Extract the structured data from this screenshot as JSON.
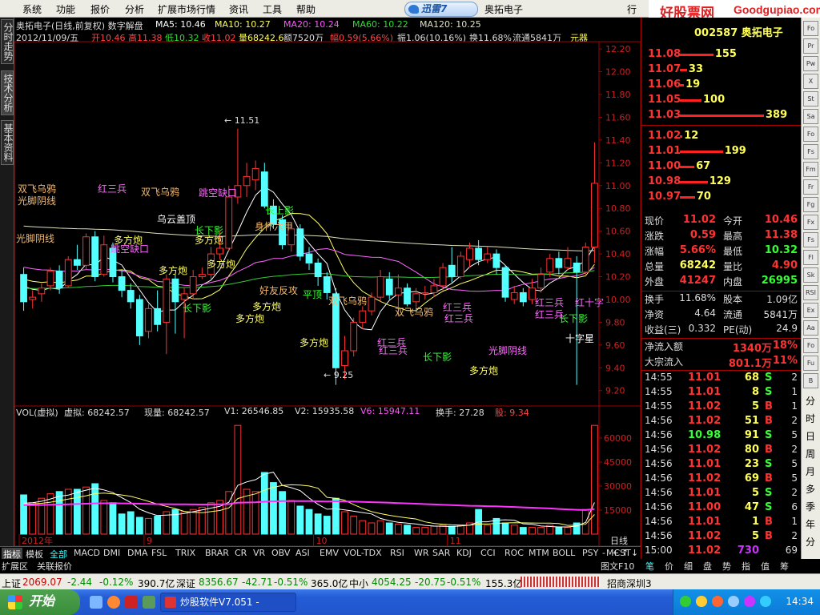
{
  "menu": [
    "系统",
    "功能",
    "报价",
    "分析",
    "扩展市场行情",
    "资讯",
    "工具",
    "帮助"
  ],
  "xunlei_label": "迅雷7",
  "window_stock_name": "奥拓电子",
  "top_right_buttons": [
    "行",
    "服务",
    "股票软件公式"
  ],
  "brand": {
    "cn": "好股票网",
    "en": "Goodgupiao.com"
  },
  "left_tabs": [
    "分时走势",
    "技术分析",
    "基本资料"
  ],
  "header": {
    "title": "奥拓电子(日线,前复权) 数字解盘",
    "ma5": "MA5: 10.46",
    "ma10": "MA10: 10.27",
    "ma20": "MA20: 10.24",
    "ma60": "MA60: 10.22",
    "ma120": "MA120: 10.25",
    "date": "2012/11/09/五",
    "open": "开10.46",
    "high": "高11.38",
    "low": "低10.32",
    "close": "收11.02",
    "vol": "量68242.6",
    "amt": "额7520万",
    "chg": "幅0.59(5.66%)",
    "amp": "振1.06(10.16%)",
    "turn": "换11.68%",
    "float": "流通5841万",
    "unit": "元器"
  },
  "vol_header": {
    "title": "VOL(虚拟)",
    "virt": "虚拟: 68242.57",
    "now": "现量: 68242.57",
    "v1": "V1: 26546.85",
    "v2": "V2: 15935.58",
    "v6": "V6: 15947.11",
    "turn": "换手: 27.28",
    "gu": "股: 9.34"
  },
  "price_axis": [
    "12.20",
    "12.00",
    "11.80",
    "11.60",
    "11.40",
    "11.20",
    "11.00",
    "10.80",
    "10.60",
    "10.40",
    "10.20",
    "10.00",
    "9.80",
    "9.60",
    "9.40",
    "9.20"
  ],
  "vol_axis": [
    "60000",
    "45000",
    "30000",
    "15000"
  ],
  "date_axis": [
    "2012年",
    "9",
    "10",
    "11"
  ],
  "period_label": "日线",
  "annotations": [
    {
      "t": "双飞乌鸦",
      "c": "#f0b870"
    },
    {
      "t": "光脚阴线",
      "c": "#f0b870"
    },
    {
      "t": "红三兵",
      "c": "#ff66ff"
    },
    {
      "t": "双飞乌鸦",
      "c": "#f0b870"
    },
    {
      "t": "光脚阴线",
      "c": "#f0b870"
    },
    {
      "t": "长下影",
      "c": "#33ff33"
    },
    {
      "t": "多方炮",
      "c": "#ffff66"
    },
    {
      "t": "跳空缺口",
      "c": "#ff66ff"
    },
    {
      "t": "多方炮",
      "c": "#ffff66"
    },
    {
      "t": "乌云盖顶",
      "c": "#ffffff"
    },
    {
      "t": "多方炮",
      "c": "#ffff66"
    },
    {
      "t": "身怀六甲",
      "c": "#f0b870"
    },
    {
      "t": "跳空缺口",
      "c": "#ff66ff"
    },
    {
      "t": "长上影",
      "c": "#33ff33"
    },
    {
      "t": "多方炮",
      "c": "#ffff66"
    },
    {
      "t": "长下影",
      "c": "#33ff33"
    },
    {
      "t": "多方炮",
      "c": "#ffff66"
    },
    {
      "t": "多方炮",
      "c": "#ffff66"
    },
    {
      "t": "好友反攻",
      "c": "#f0b870"
    },
    {
      "t": "平顶",
      "c": "#33ff33"
    },
    {
      "t": "双飞乌鸦",
      "c": "#f0b870"
    },
    {
      "t": "多方炮",
      "c": "#ffff66"
    },
    {
      "t": "红三兵",
      "c": "#ff66ff"
    },
    {
      "t": "红三兵",
      "c": "#ff66ff"
    },
    {
      "t": "双飞乌鸦",
      "c": "#f0b870"
    },
    {
      "t": "红三兵",
      "c": "#ff66ff"
    },
    {
      "t": "红三兵",
      "c": "#ff66ff"
    },
    {
      "t": "长下影",
      "c": "#33ff33"
    },
    {
      "t": "光脚阴线",
      "c": "#ff66ff"
    },
    {
      "t": "多方炮",
      "c": "#ffff66"
    },
    {
      "t": "红三兵",
      "c": "#ff66ff"
    },
    {
      "t": "红三兵",
      "c": "#ff66ff"
    },
    {
      "t": "长下影",
      "c": "#33ff33"
    },
    {
      "t": "十字星",
      "c": "#ffffff"
    },
    {
      "t": "大阴烛",
      "c": "#33ffff"
    },
    {
      "t": "红十字",
      "c": "#ff66ff"
    }
  ],
  "extreme_marks": {
    "high": "11.51",
    "low": "9.25"
  },
  "indicator_tabs": [
    "指标",
    "模板",
    "全部",
    "MACD",
    "DMI",
    "DMA",
    "FSL",
    "TRIX",
    "BRAR",
    "CR",
    "VR",
    "OBV",
    "ASI",
    "EMV",
    "VOL-TDX",
    "RSI",
    "WR",
    "SAR",
    "KDJ",
    "CCI",
    "ROC",
    "MTM",
    "BOLL",
    "PSY",
    "MCST"
  ],
  "ext_tabs": [
    "扩展区",
    "关联报价"
  ],
  "right_panel": {
    "code": "002587 奥拓电子",
    "asks": [
      {
        "p": "11.08",
        "v": "155"
      },
      {
        "p": "11.07",
        "v": "33"
      },
      {
        "p": "11.06",
        "v": "19"
      },
      {
        "p": "11.05",
        "v": "100"
      },
      {
        "p": "11.03",
        "v": "389"
      }
    ],
    "bids": [
      {
        "p": "11.02",
        "v": "12"
      },
      {
        "p": "11.01",
        "v": "199"
      },
      {
        "p": "11.00",
        "v": "67"
      },
      {
        "p": "10.98",
        "v": "129"
      },
      {
        "p": "10.97",
        "v": "70"
      }
    ],
    "quote": [
      {
        "l1": "现价",
        "v1": "11.02",
        "l2": "今开",
        "v2": "10.46"
      },
      {
        "l1": "涨跌",
        "v1": "0.59",
        "l2": "最高",
        "v2": "11.38"
      },
      {
        "l1": "涨幅",
        "v1": "5.66%",
        "l2": "最低",
        "v2": "10.32"
      },
      {
        "l1": "总量",
        "v1": "68242",
        "l2": "量比",
        "v2": "4.90"
      },
      {
        "l1": "外盘",
        "v1": "41247",
        "l2": "内盘",
        "v2": "26995"
      }
    ],
    "fund": [
      {
        "l1": "换手",
        "v1": "11.68%",
        "l2": "股本",
        "v2": "1.09亿"
      },
      {
        "l1": "净资",
        "v1": "4.64",
        "l2": "流通",
        "v2": "5841万"
      },
      {
        "l1": "收益(三)",
        "v1": "0.332",
        "l2": "PE(动)",
        "v2": "24.9"
      }
    ],
    "flow": [
      {
        "l": "净流入额",
        "v": "1340万",
        "p": "18%"
      },
      {
        "l": "大宗流入",
        "v": "801.1万",
        "p": "11%"
      }
    ],
    "ticks": [
      {
        "t": "14:55",
        "p": "11.01",
        "v": "68",
        "s": "S",
        "n": "2"
      },
      {
        "t": "14:55",
        "p": "11.01",
        "v": "8",
        "s": "S",
        "n": "1"
      },
      {
        "t": "14:55",
        "p": "11.02",
        "v": "5",
        "s": "B",
        "n": "1"
      },
      {
        "t": "14:56",
        "p": "11.02",
        "v": "51",
        "s": "B",
        "n": "2"
      },
      {
        "t": "14:56",
        "p": "10.98",
        "v": "91",
        "s": "S",
        "n": "5"
      },
      {
        "t": "14:56",
        "p": "11.02",
        "v": "80",
        "s": "B",
        "n": "2"
      },
      {
        "t": "14:56",
        "p": "11.01",
        "v": "23",
        "s": "S",
        "n": "5"
      },
      {
        "t": "14:56",
        "p": "11.02",
        "v": "69",
        "s": "B",
        "n": "5"
      },
      {
        "t": "14:56",
        "p": "11.01",
        "v": "5",
        "s": "S",
        "n": "2"
      },
      {
        "t": "14:56",
        "p": "11.00",
        "v": "47",
        "s": "S",
        "n": "6"
      },
      {
        "t": "14:56",
        "p": "11.01",
        "v": "1",
        "s": "B",
        "n": "1"
      },
      {
        "t": "14:56",
        "p": "11.02",
        "v": "5",
        "s": "B",
        "n": "2"
      },
      {
        "t": "15:00",
        "p": "11.02",
        "v": "730",
        "s": "",
        "n": "69"
      }
    ],
    "cat_tabs": [
      "笔",
      "价",
      "细",
      "盘",
      "势",
      "指",
      "值",
      "筹"
    ]
  },
  "right_side_chars": [
    "分",
    "时",
    "日",
    "周",
    "月",
    "多",
    "季",
    "年",
    "分"
  ],
  "nav_buttons": [
    "-",
    "+",
    "↑",
    "↓",
    "→",
    "图文F10"
  ],
  "status": {
    "sh_label": "上证",
    "sh": "2069.07",
    "sh_chg": "-2.44",
    "sh_pct": "-0.12%",
    "sh_amt": "390.7亿",
    "sz_label": "深证",
    "sz": "8356.67",
    "sz_chg": "-42.71",
    "sz_pct": "-0.51%",
    "sz_amt": "365.0亿",
    "zx_label": "中小",
    "zx": "4054.25",
    "zx_chg": "-20.75",
    "zx_pct": "-0.51%",
    "zx_amt": "155.3亿",
    "broker": "招商深圳3"
  },
  "taskbar": {
    "start": "开始",
    "app": "炒股软件V7.051 -",
    "clock": "14:34"
  },
  "chart_data": {
    "type": "candlestick",
    "price_range": [
      9.17,
      12.25
    ],
    "volume_range": [
      0,
      70000
    ],
    "candles": [
      [
        10.22,
        9.98,
        10.28,
        9.9,
        0.35
      ],
      [
        10.0,
        10.02,
        10.08,
        9.92,
        0.28
      ],
      [
        10.05,
        10.1,
        10.14,
        9.98,
        0.32
      ],
      [
        10.12,
        10.25,
        10.28,
        10.08,
        0.36
      ],
      [
        10.25,
        10.1,
        10.3,
        10.05,
        0.38
      ],
      [
        10.12,
        10.35,
        10.38,
        10.1,
        0.4
      ],
      [
        10.35,
        10.3,
        10.48,
        10.26,
        0.4
      ],
      [
        10.3,
        10.55,
        10.58,
        10.26,
        0.42
      ],
      [
        10.55,
        10.2,
        10.6,
        10.16,
        0.45
      ],
      [
        10.22,
        10.48,
        10.56,
        10.2,
        0.3
      ],
      [
        10.45,
        10.2,
        10.5,
        10.15,
        0.28
      ],
      [
        10.2,
        10.08,
        10.26,
        10.02,
        0.18
      ],
      [
        10.08,
        9.98,
        10.14,
        9.92,
        0.2
      ],
      [
        10.0,
        9.68,
        10.04,
        9.6,
        0.15
      ],
      [
        9.72,
        9.92,
        9.96,
        9.66,
        0.14
      ],
      [
        9.92,
        9.78,
        10.08,
        9.72,
        0.16
      ],
      [
        9.8,
        10.18,
        10.22,
        9.52,
        0.2
      ],
      [
        10.18,
        9.98,
        10.22,
        9.7,
        0.22
      ],
      [
        10.0,
        10.05,
        10.1,
        9.66,
        0.2
      ],
      [
        10.05,
        10.2,
        10.26,
        10.0,
        0.22
      ],
      [
        10.2,
        10.22,
        10.28,
        10.18,
        0.24
      ],
      [
        10.22,
        10.4,
        10.46,
        10.18,
        0.28
      ],
      [
        10.4,
        10.45,
        10.6,
        10.35,
        0.3
      ],
      [
        10.45,
        10.9,
        11.0,
        10.42,
        0.38
      ],
      [
        10.9,
        11.0,
        11.5,
        10.84,
        0.97
      ],
      [
        11.0,
        11.08,
        11.2,
        10.9,
        0.4
      ],
      [
        11.05,
        11.15,
        11.22,
        10.96,
        0.38
      ],
      [
        11.12,
        10.82,
        11.2,
        10.8,
        0.55
      ],
      [
        10.82,
        10.66,
        10.88,
        10.62,
        0.46
      ],
      [
        10.7,
        10.48,
        10.74,
        10.44,
        0.38
      ],
      [
        10.48,
        10.62,
        10.66,
        10.42,
        0.3
      ],
      [
        10.62,
        10.38,
        10.66,
        10.34,
        0.25
      ],
      [
        10.4,
        10.32,
        10.46,
        10.26,
        0.22
      ],
      [
        10.32,
        10.2,
        10.36,
        10.12,
        0.18
      ],
      [
        10.2,
        10.06,
        10.24,
        10.0,
        0.16
      ],
      [
        10.05,
        9.4,
        10.1,
        9.25,
        0.32
      ],
      [
        9.42,
        9.55,
        9.68,
        9.3,
        0.2
      ],
      [
        9.55,
        9.8,
        9.84,
        9.5,
        0.16
      ],
      [
        9.8,
        9.9,
        9.94,
        9.74,
        0.12
      ],
      [
        9.9,
        10.02,
        10.06,
        9.86,
        0.1
      ],
      [
        10.02,
        10.2,
        10.26,
        9.98,
        0.12
      ],
      [
        10.18,
        10.04,
        10.24,
        10.0,
        0.1
      ],
      [
        10.04,
        10.1,
        10.22,
        9.85,
        0.09
      ],
      [
        10.1,
        9.96,
        10.14,
        9.94,
        0.08
      ],
      [
        9.98,
        10.05,
        10.1,
        9.92,
        0.06
      ],
      [
        10.05,
        10.06,
        10.12,
        10.0,
        0.06
      ],
      [
        10.06,
        10.12,
        10.18,
        10.02,
        0.07
      ],
      [
        10.12,
        10.28,
        10.32,
        10.08,
        0.08
      ],
      [
        10.3,
        10.2,
        10.46,
        10.15,
        0.07
      ],
      [
        10.2,
        10.38,
        10.42,
        10.18,
        0.08
      ],
      [
        10.35,
        10.45,
        10.5,
        10.28,
        0.1
      ],
      [
        10.45,
        10.35,
        10.52,
        10.3,
        0.22
      ],
      [
        10.35,
        10.4,
        10.46,
        10.32,
        0.08
      ],
      [
        10.4,
        10.28,
        10.44,
        10.22,
        0.14
      ],
      [
        10.28,
        10.02,
        10.3,
        9.98,
        0.1
      ],
      [
        10.0,
        10.06,
        10.12,
        9.96,
        0.08
      ],
      [
        10.06,
        9.98,
        10.1,
        9.94,
        0.06
      ],
      [
        10.0,
        10.1,
        10.18,
        9.96,
        0.06
      ],
      [
        10.1,
        10.22,
        10.28,
        10.06,
        0.06
      ],
      [
        10.24,
        10.36,
        10.4,
        10.2,
        0.08
      ],
      [
        10.36,
        10.28,
        10.42,
        10.22,
        0.06
      ],
      [
        10.28,
        10.36,
        10.46,
        10.26,
        0.06
      ],
      [
        10.32,
        10.24,
        10.38,
        9.25,
        0.1
      ],
      [
        10.24,
        10.46,
        10.5,
        10.2,
        0.22
      ],
      [
        10.46,
        11.02,
        11.38,
        10.32,
        0.97
      ]
    ],
    "ma_lines": [
      {
        "name": "MA5",
        "color": "#ffffff"
      },
      {
        "name": "MA10",
        "color": "#ffff66"
      },
      {
        "name": "MA20",
        "color": "#ff66ff"
      },
      {
        "name": "MA60",
        "color": "#33cc33"
      },
      {
        "name": "MA120",
        "color": "#e0e0c0"
      }
    ]
  }
}
